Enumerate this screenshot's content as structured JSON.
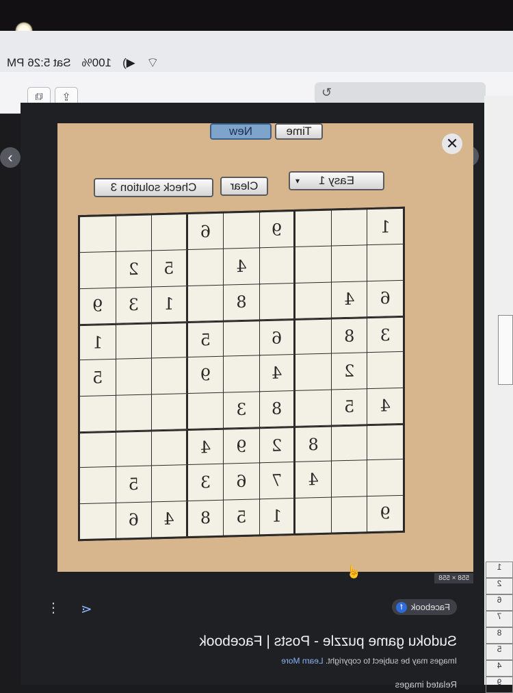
{
  "status_bar": {
    "clock": "Sat 5:26 PM",
    "battery": "100%",
    "wifi_icon": "wifi-icon",
    "volume_icon": "speaker-icon"
  },
  "toolbar": {
    "reload_icon": "reload-icon",
    "share_icon": "share-icon",
    "tabs_icon": "tabs-icon"
  },
  "game": {
    "time_label": "Time",
    "new_label": "New",
    "difficulty": "Easy 1",
    "clear_label": "Clear",
    "check_label": "Check solution 3",
    "grid": [
      [
        "1",
        "",
        "",
        "9",
        "",
        "6",
        "",
        "",
        ""
      ],
      [
        "",
        "",
        "",
        "",
        "4",
        "",
        "5",
        "2",
        ""
      ],
      [
        "6",
        "4",
        "",
        "",
        "8",
        "",
        "1",
        "3",
        "9"
      ],
      [
        "3",
        "8",
        "",
        "6",
        "",
        "5",
        "",
        "",
        "1"
      ],
      [
        "",
        "2",
        "",
        "4",
        "",
        "9",
        "",
        "",
        "5"
      ],
      [
        "4",
        "5",
        "",
        "8",
        "3",
        "",
        "",
        "",
        ""
      ],
      [
        "",
        "",
        "8",
        "2",
        "9",
        "4",
        "",
        "",
        ""
      ],
      [
        "",
        "",
        "4",
        "7",
        "6",
        "3",
        "",
        "5",
        ""
      ],
      [
        "9",
        "",
        "",
        "1",
        "5",
        "8",
        "4",
        "6",
        ""
      ]
    ],
    "dimensions": "558 × 558"
  },
  "result": {
    "source": "Facebook",
    "title": "Sudoku game puzzle - Posts | Facebook",
    "copyright": "Images may be subject to copyright.",
    "learn_more": "Learn More",
    "related": "Related images"
  },
  "side_numbers": [
    "1",
    "2",
    "6",
    "7",
    "8",
    "5",
    "4",
    "9"
  ]
}
